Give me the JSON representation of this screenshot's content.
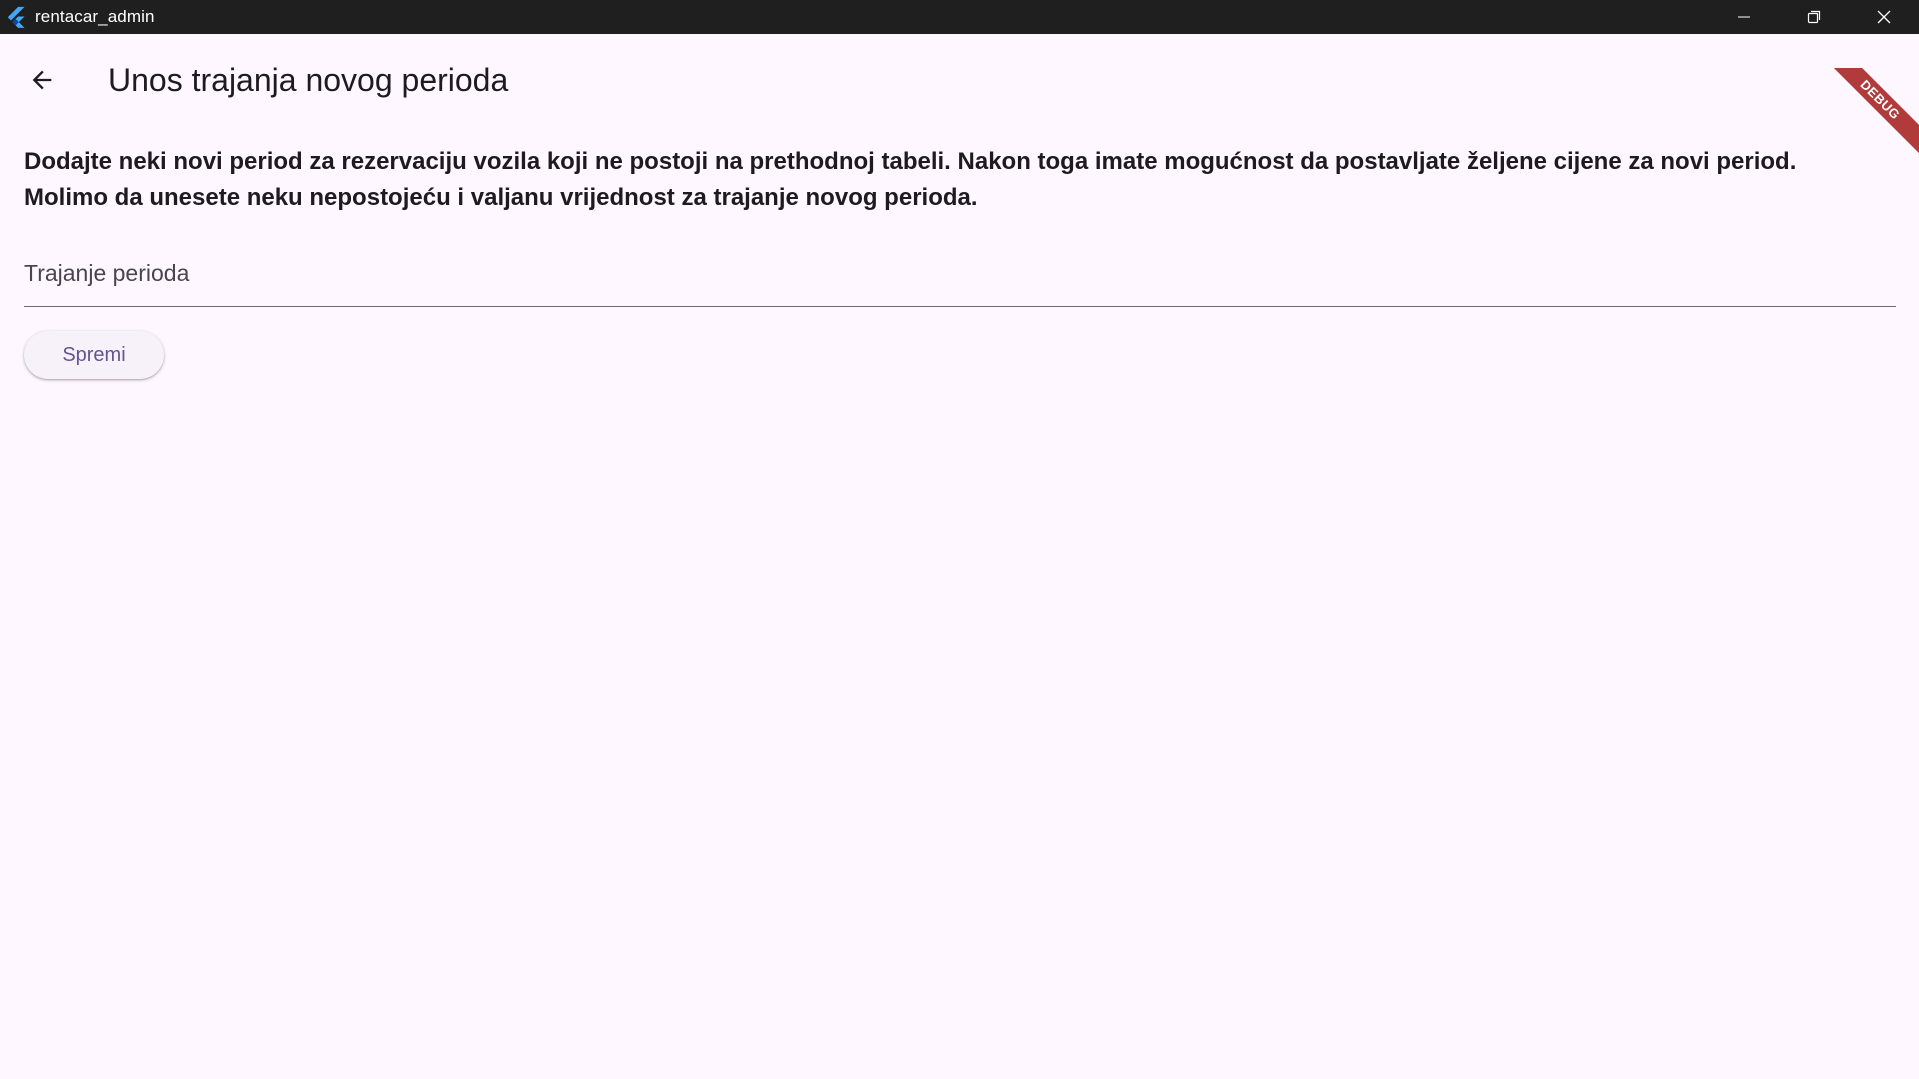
{
  "window": {
    "title": "rentacar_admin",
    "controls": [
      "minimize-icon",
      "restore-icon",
      "close-icon"
    ]
  },
  "app_bar": {
    "back_icon": "arrow-left-icon",
    "title": "Unos trajanja novog perioda"
  },
  "content": {
    "description_line_1": "Dodajte neki novi period za rezervaciju vozila koji ne postoji na prethodnoj tabeli. Nakon toga imate mogućnost da postavljate željene cijene za novi period.",
    "description_line_2": "Molimo da unesete neku nepostojeću i valjanu vrijednost za trajanje novog perioda.",
    "input_value": "",
    "input_placeholder": "Trajanje perioda",
    "save_label": "Spremi"
  },
  "debug_banner": "DEBUG",
  "colors": {
    "background": "#fef7ff",
    "titlebar": "#1f1f1f",
    "accent": "#65558f",
    "debug": "#b13a3a"
  }
}
